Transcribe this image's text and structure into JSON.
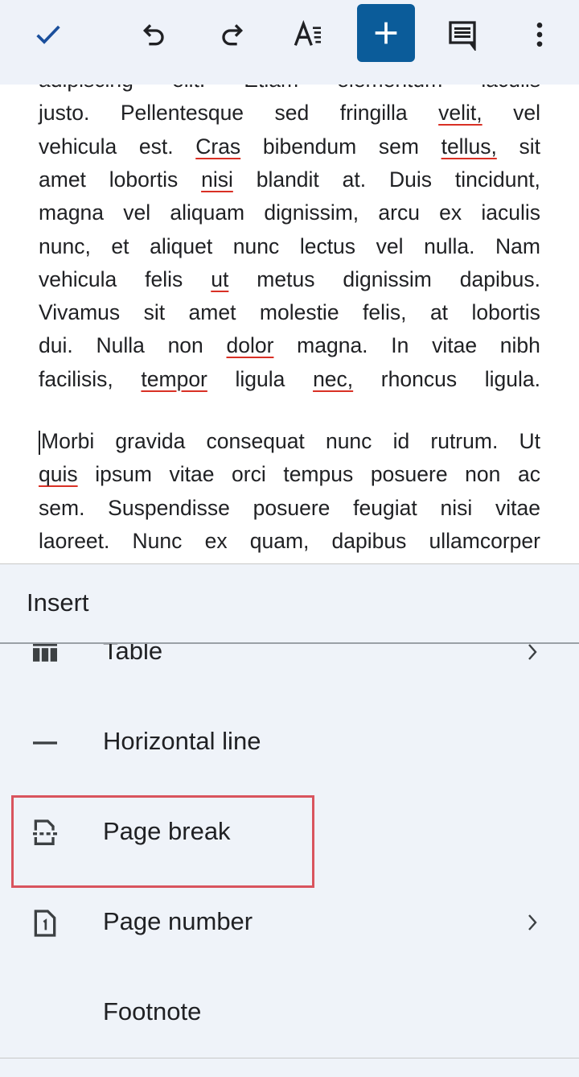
{
  "toolbar": {
    "buttons": [
      {
        "name": "done-button",
        "icon": "check-icon"
      },
      {
        "name": "undo-button",
        "icon": "undo-icon"
      },
      {
        "name": "redo-button",
        "icon": "redo-icon"
      },
      {
        "name": "text-format-button",
        "icon": "text-format-icon"
      },
      {
        "name": "insert-button",
        "icon": "plus-icon",
        "active": true
      },
      {
        "name": "comment-button",
        "icon": "comment-icon"
      },
      {
        "name": "more-options-button",
        "icon": "more-vert-icon"
      }
    ],
    "accent": "#0b5c9a",
    "check_color": "#1a4f9c"
  },
  "document": {
    "paragraph1": [
      [
        [
          "adipiscing",
          0
        ],
        [
          "elit.",
          0
        ],
        [
          "Etiam",
          0
        ],
        [
          "elementum",
          0
        ],
        [
          "iaculis",
          0
        ]
      ],
      [
        [
          "justo.",
          0
        ],
        [
          "Pellentesque",
          0
        ],
        [
          "sed",
          0
        ],
        [
          "fringilla",
          0
        ],
        [
          "velit,",
          1
        ],
        [
          "vel",
          0
        ]
      ],
      [
        [
          "vehicula",
          0
        ],
        [
          "est.",
          0
        ],
        [
          "Cras",
          1
        ],
        [
          "bibendum",
          0
        ],
        [
          "sem",
          0
        ],
        [
          "tellus,",
          1
        ],
        [
          "sit",
          0
        ]
      ],
      [
        [
          "amet",
          0
        ],
        [
          "lobortis",
          0
        ],
        [
          "nisi",
          1
        ],
        [
          "blandit",
          0
        ],
        [
          "at.",
          0
        ],
        [
          "Duis",
          0
        ],
        [
          "tincidunt,",
          0
        ]
      ],
      [
        [
          "magna",
          0
        ],
        [
          "vel",
          0
        ],
        [
          "aliquam",
          0
        ],
        [
          "dignissim,",
          0
        ],
        [
          "arcu",
          0
        ],
        [
          "ex",
          0
        ],
        [
          "iaculis",
          0
        ]
      ],
      [
        [
          "nunc,",
          0
        ],
        [
          "et",
          0
        ],
        [
          "aliquet",
          0
        ],
        [
          "nunc",
          0
        ],
        [
          "lectus",
          0
        ],
        [
          "vel",
          0
        ],
        [
          "nulla.",
          0
        ],
        [
          "Nam",
          0
        ]
      ],
      [
        [
          "vehicula",
          0
        ],
        [
          "felis",
          0
        ],
        [
          "ut",
          1
        ],
        [
          "metus",
          0
        ],
        [
          "dignissim",
          0
        ],
        [
          "dapibus.",
          0
        ]
      ],
      [
        [
          "Vivamus",
          0
        ],
        [
          "sit",
          0
        ],
        [
          "amet",
          0
        ],
        [
          "molestie",
          0
        ],
        [
          "felis,",
          0
        ],
        [
          "at",
          0
        ],
        [
          "lobortis",
          0
        ]
      ],
      [
        [
          "dui.",
          0
        ],
        [
          "Nulla",
          0
        ],
        [
          "non",
          0
        ],
        [
          "dolor",
          1
        ],
        [
          "magna.",
          0
        ],
        [
          "In",
          0
        ],
        [
          "vitae",
          0
        ],
        [
          "nibh",
          0
        ]
      ],
      [
        [
          "facilisis,",
          0
        ],
        [
          "tempor",
          1
        ],
        [
          "ligula",
          0
        ],
        [
          "nec,",
          1
        ],
        [
          "rhoncus",
          0
        ],
        [
          "ligula.",
          0
        ]
      ]
    ],
    "paragraph2": [
      [
        [
          "Morbi",
          0
        ],
        [
          "gravida",
          0
        ],
        [
          "consequat",
          0
        ],
        [
          "nunc",
          0
        ],
        [
          "id",
          0
        ],
        [
          "rutrum.",
          0
        ],
        [
          "Ut",
          0
        ]
      ],
      [
        [
          "quis",
          1
        ],
        [
          "ipsum",
          0
        ],
        [
          "vitae",
          0
        ],
        [
          "orci",
          0
        ],
        [
          "tempus",
          0
        ],
        [
          "posuere",
          0
        ],
        [
          "non",
          0
        ],
        [
          "ac",
          0
        ]
      ],
      [
        [
          "sem.",
          0
        ],
        [
          "Suspendisse",
          0
        ],
        [
          "posuere",
          0
        ],
        [
          "feugiat",
          0
        ],
        [
          "nisi",
          0
        ],
        [
          "vitae",
          0
        ]
      ],
      [
        [
          "laoreet.",
          0
        ],
        [
          "Nunc",
          0
        ],
        [
          "ex",
          0
        ],
        [
          "quam,",
          0
        ],
        [
          "dapibus",
          0
        ],
        [
          "ullamcorper",
          0
        ]
      ]
    ],
    "misspelling_color": "#d93025"
  },
  "insert_sheet": {
    "title": "Insert",
    "items": [
      {
        "label": "Table",
        "icon": "table-icon",
        "submenu": true
      },
      {
        "label": "Horizontal line",
        "icon": "horizontal-line-icon",
        "submenu": false
      },
      {
        "label": "Page break",
        "icon": "page-break-icon",
        "submenu": false,
        "highlighted": true
      },
      {
        "label": "Page number",
        "icon": "page-number-icon",
        "submenu": true
      },
      {
        "label": "Footnote",
        "icon": "",
        "submenu": false
      }
    ],
    "highlight_color": "#d9545e"
  }
}
